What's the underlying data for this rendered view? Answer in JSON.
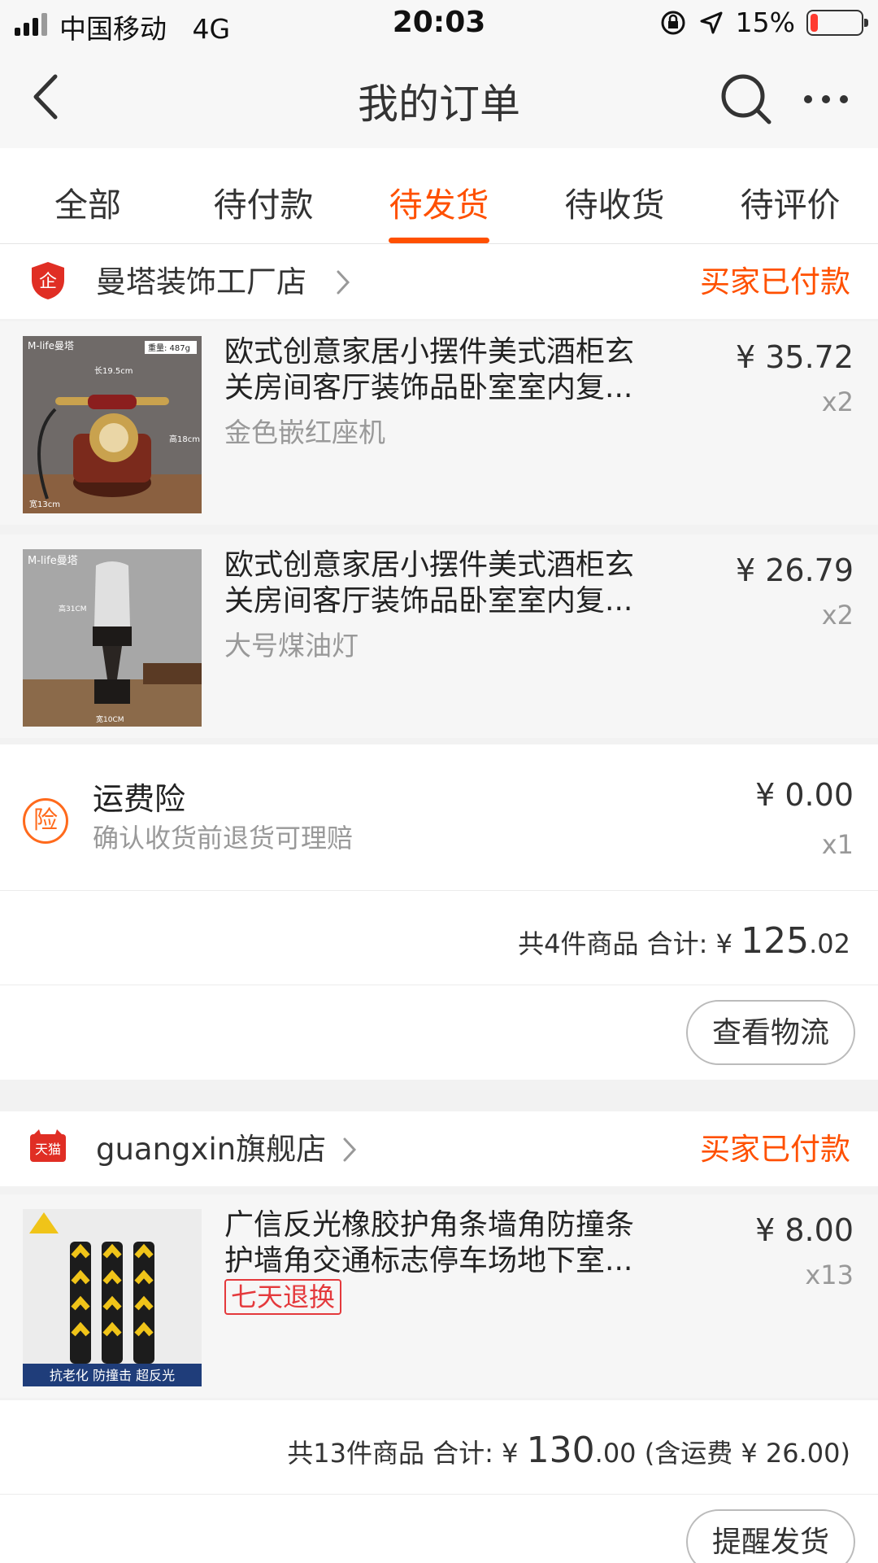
{
  "status_bar": {
    "carrier": "中国移动",
    "network": "4G",
    "time": "20:03",
    "battery_pct": "15%",
    "battery_level": 0.15
  },
  "nav": {
    "title": "我的订单",
    "back_icon": "back-arrow-icon",
    "search_icon": "search-icon",
    "more_icon": "more-dots-icon"
  },
  "tabs": [
    {
      "label": "全部",
      "active": false
    },
    {
      "label": "待付款",
      "active": false
    },
    {
      "label": "待发货",
      "active": true
    },
    {
      "label": "待收货",
      "active": false
    },
    {
      "label": "待评价",
      "active": false
    }
  ],
  "orders": [
    {
      "shop_name": "曼塔装饰工厂店",
      "shop_icon": "enterprise-shield-icon",
      "status": "买家已付款",
      "items": [
        {
          "title_line1": "欧式创意家居小摆件美式酒柜玄",
          "title_line2": "关房间客厅装饰品卧室室内复...",
          "sku": "金色嵌红座机",
          "price": "¥ 35.72",
          "qty": "x2",
          "image_brand": "M-life曼塔",
          "image_weight": "重量: 487g",
          "image_length": "长19.5cm",
          "image_height": "高18cm",
          "image_width": "宽13cm"
        },
        {
          "title_line1": "欧式创意家居小摆件美式酒柜玄",
          "title_line2": "关房间客厅装饰品卧室室内复...",
          "sku": "大号煤油灯",
          "price": "¥ 26.79",
          "qty": "x2",
          "image_brand": "M-life曼塔",
          "image_height": "高31CM",
          "image_width": "宽10CM"
        }
      ],
      "insurance": {
        "icon_char": "险",
        "title": "运费险",
        "desc": "确认收货前退货可理赔",
        "price": "¥ 0.00",
        "qty": "x1"
      },
      "total_prefix": "共4件商品 合计: ¥ ",
      "total_int": "125",
      "total_dec": ".02",
      "total_suffix": "",
      "action": "查看物流"
    },
    {
      "shop_name": "guangxin旗舰店",
      "shop_icon": "tmall-icon",
      "shop_icon_text": "天猫",
      "status": "买家已付款",
      "items": [
        {
          "title_line1": "广信反光橡胶护角条墙角防撞条",
          "title_line2": "护墙角交通标志停车场地下室...",
          "badge": "七天退换",
          "price": "¥ 8.00",
          "qty": "x13",
          "image_caption": "抗老化 防撞击 超反光"
        }
      ],
      "total_prefix": "共13件商品 合计: ¥ ",
      "total_int": "130",
      "total_dec": ".00",
      "total_suffix": " (含运费 ¥ 26.00)",
      "action": "提醒发货"
    }
  ],
  "colors": {
    "accent": "#ff5000",
    "badge_red": "#e4393c",
    "page_bg": "#f2f2f2"
  }
}
